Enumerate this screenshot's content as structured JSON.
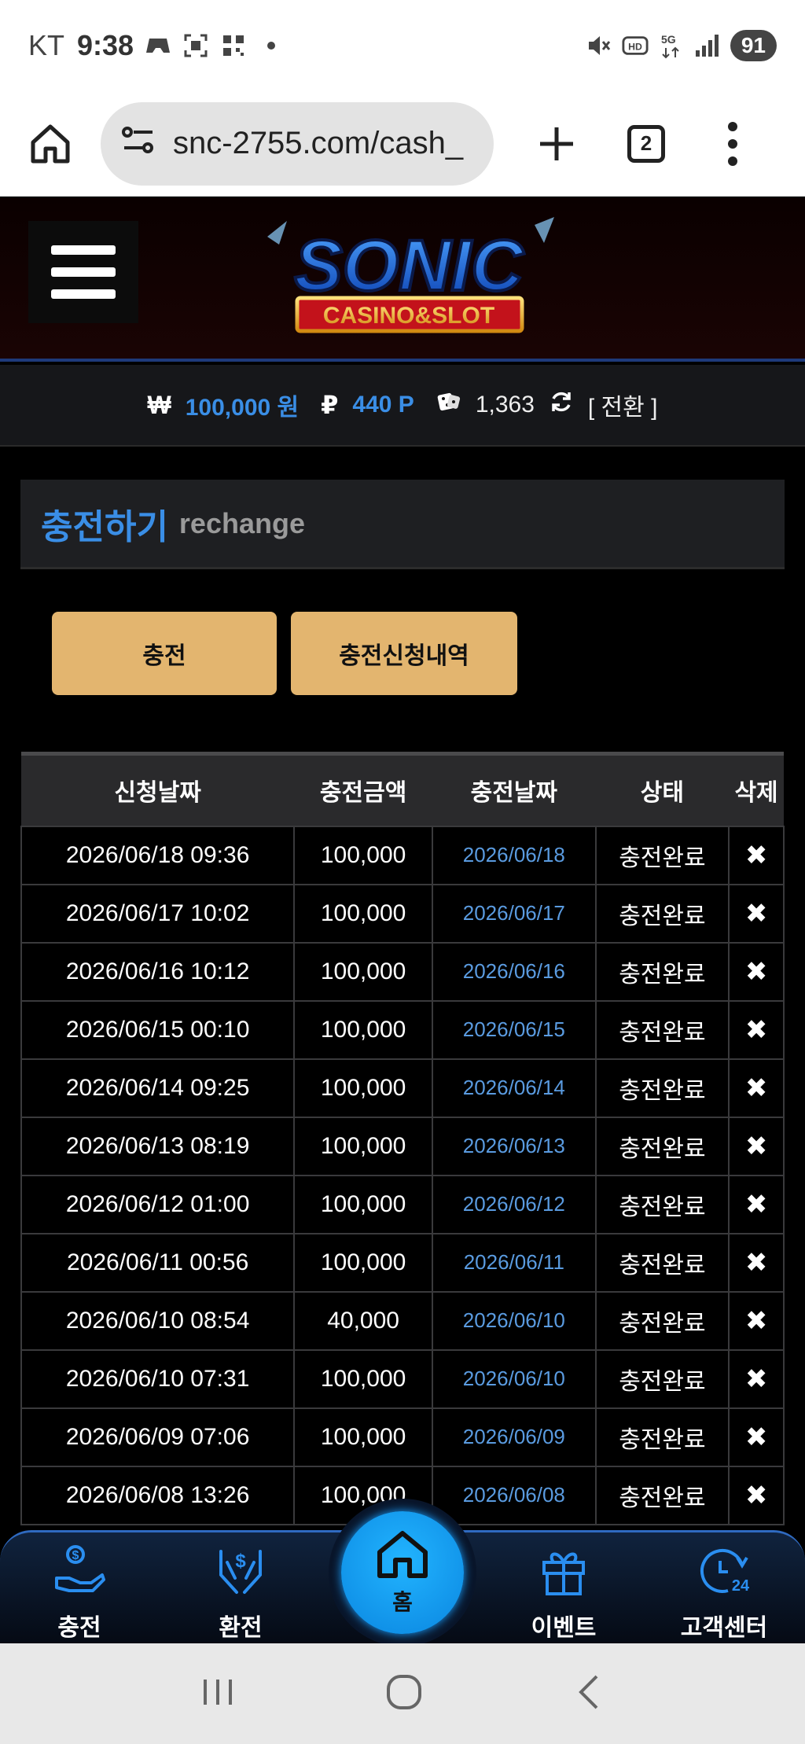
{
  "status_bar": {
    "carrier": "KT",
    "time": "9:38",
    "battery": "91",
    "icons": [
      "game-icon",
      "screenshot-icon",
      "qr-icon",
      "dot-icon",
      "mute-icon",
      "hd-icon",
      "5g-icon",
      "signal-icon"
    ]
  },
  "browser": {
    "url": "snc-2755.com/cash_",
    "tab_count": "2"
  },
  "header": {
    "logo_main": "SONIC",
    "logo_sub": "CASINO&SLOT"
  },
  "balance": {
    "won_symbol": "₩",
    "won_value": "100,000 원",
    "point_symbol": "₽",
    "point_value": "440 P",
    "chip_count": "1,363",
    "convert_label": "[ 전환 ]"
  },
  "page_title": {
    "korean": "충전하기",
    "english": "rechange"
  },
  "tabs": {
    "charge": "충전",
    "history": "충전신청내역"
  },
  "table": {
    "headers": [
      "신청날짜",
      "충전금액",
      "충전날짜",
      "상태",
      "삭제"
    ],
    "delete_symbol": "✖",
    "rows": [
      {
        "request": "2026/06/18 09:36",
        "amount": "100,000",
        "date": "2026/06/18",
        "status": "충전완료"
      },
      {
        "request": "2026/06/17 10:02",
        "amount": "100,000",
        "date": "2026/06/17",
        "status": "충전완료"
      },
      {
        "request": "2026/06/16 10:12",
        "amount": "100,000",
        "date": "2026/06/16",
        "status": "충전완료"
      },
      {
        "request": "2026/06/15 00:10",
        "amount": "100,000",
        "date": "2026/06/15",
        "status": "충전완료"
      },
      {
        "request": "2026/06/14 09:25",
        "amount": "100,000",
        "date": "2026/06/14",
        "status": "충전완료"
      },
      {
        "request": "2026/06/13 08:19",
        "amount": "100,000",
        "date": "2026/06/13",
        "status": "충전완료"
      },
      {
        "request": "2026/06/12 01:00",
        "amount": "100,000",
        "date": "2026/06/12",
        "status": "충전완료"
      },
      {
        "request": "2026/06/11 00:56",
        "amount": "100,000",
        "date": "2026/06/11",
        "status": "충전완료"
      },
      {
        "request": "2026/06/10 08:54",
        "amount": "40,000",
        "date": "2026/06/10",
        "status": "충전완료"
      },
      {
        "request": "2026/06/10 07:31",
        "amount": "100,000",
        "date": "2026/06/10",
        "status": "충전완료"
      },
      {
        "request": "2026/06/09 07:06",
        "amount": "100,000",
        "date": "2026/06/09",
        "status": "충전완료"
      },
      {
        "request": "2026/06/08 13:26",
        "amount": "100,000",
        "date": "2026/06/08",
        "status": "충전완료"
      }
    ]
  },
  "bottom_nav": {
    "charge": "충전",
    "exchange": "환전",
    "home": "홈",
    "event": "이벤트",
    "support": "고객센터"
  },
  "colors": {
    "accent_blue": "#3a8ee6",
    "button_gold": "#e3b56f",
    "nav_home_blue": "#1aa0ff"
  }
}
